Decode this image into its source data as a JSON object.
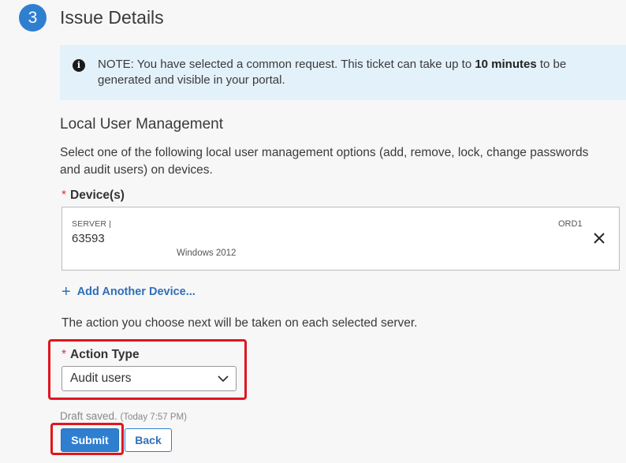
{
  "step": {
    "number": "3",
    "title": "Issue Details"
  },
  "note": {
    "prefix": "NOTE:",
    "text_before": " You have selected a common request. This ticket can take up to ",
    "bold": "10 minutes",
    "text_after": " to be generated and visible in your portal."
  },
  "section": {
    "title": "Local User Management",
    "description": "Select one of the following local user management options (add, remove, lock, change passwords and audit users) on devices."
  },
  "devices": {
    "required_mark": "*",
    "label": "Device(s)",
    "items": [
      {
        "type": "SERVER |",
        "id": "63593",
        "os": "Windows 2012",
        "datacenter": "ORD1"
      }
    ],
    "add_label": "Add Another Device..."
  },
  "action": {
    "note": "The action you choose next will be taken on each selected server.",
    "required_mark": "*",
    "label": "Action Type",
    "selected": "Audit users"
  },
  "draft": {
    "status": "Draft saved.",
    "time": "(Today 7:57 PM)"
  },
  "buttons": {
    "submit": "Submit",
    "back": "Back"
  },
  "colors": {
    "primary": "#2f7fd1",
    "highlight": "#e0161e",
    "note_bg": "#e3f1fb"
  }
}
